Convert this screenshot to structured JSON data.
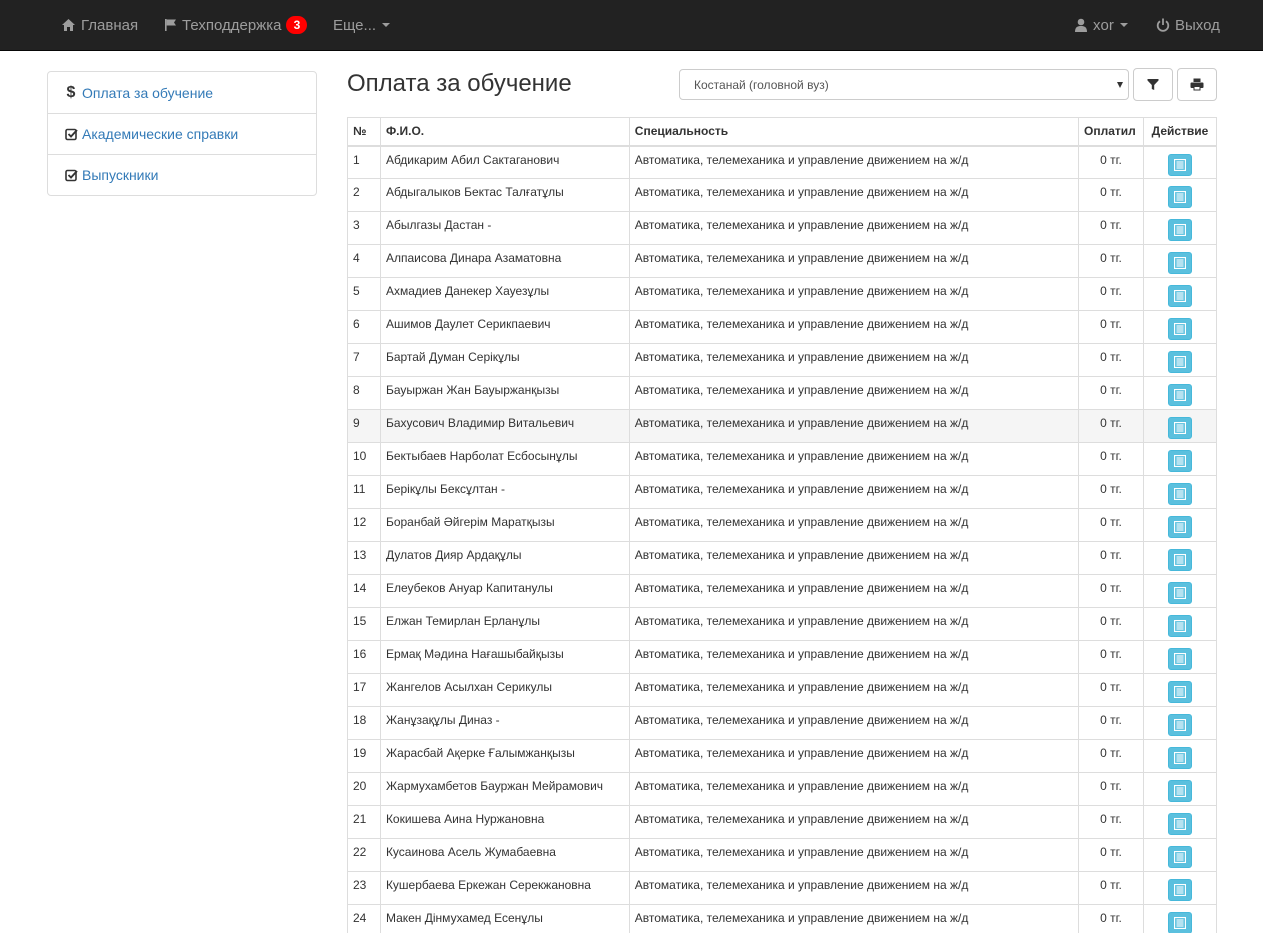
{
  "navbar": {
    "home": "Главная",
    "support": "Техподдержка",
    "support_badge": "3",
    "more": "Еще...",
    "user": "xor",
    "logout": "Выход"
  },
  "sidebar": {
    "items": [
      {
        "label": "Оплата за обучение",
        "icon": "dollar-icon"
      },
      {
        "label": "Академические справки",
        "icon": "check-square-icon"
      },
      {
        "label": "Выпускники",
        "icon": "check-square-icon"
      }
    ]
  },
  "header": {
    "title": "Оплата за обучение",
    "select_value": "Костанай (головной вуз)",
    "filter_icon": "filter-icon",
    "print_icon": "print-icon"
  },
  "table": {
    "columns": [
      "№",
      "Ф.И.О.",
      "Специальность",
      "Оплатил",
      "Действие"
    ],
    "highlighted_row": 9,
    "rows": [
      {
        "n": "1",
        "name": "Абдикарим Абил Сактаганович",
        "spec": "Автоматика, телемеханика и управление движением на ж/д",
        "paid": "0 тг."
      },
      {
        "n": "2",
        "name": "Абдыгалыков Бектас Талғатұлы",
        "spec": "Автоматика, телемеханика и управление движением на ж/д",
        "paid": "0 тг."
      },
      {
        "n": "3",
        "name": "Абылгазы Дастан -",
        "spec": "Автоматика, телемеханика и управление движением на ж/д",
        "paid": "0 тг."
      },
      {
        "n": "4",
        "name": "Алпаисова Динара Азаматовна",
        "spec": "Автоматика, телемеханика и управление движением на ж/д",
        "paid": "0 тг."
      },
      {
        "n": "5",
        "name": "Ахмадиев Данекер Хауезұлы",
        "spec": "Автоматика, телемеханика и управление движением на ж/д",
        "paid": "0 тг."
      },
      {
        "n": "6",
        "name": "Ашимов Даулет Серикпаевич",
        "spec": "Автоматика, телемеханика и управление движением на ж/д",
        "paid": "0 тг."
      },
      {
        "n": "7",
        "name": "Бартай Думан Серікұлы",
        "spec": "Автоматика, телемеханика и управление движением на ж/д",
        "paid": "0 тг."
      },
      {
        "n": "8",
        "name": "Бауыржан Жан Бауыржанқызы",
        "spec": "Автоматика, телемеханика и управление движением на ж/д",
        "paid": "0 тг."
      },
      {
        "n": "9",
        "name": "Бахусович Владимир Витальевич",
        "spec": "Автоматика, телемеханика и управление движением на ж/д",
        "paid": "0 тг."
      },
      {
        "n": "10",
        "name": "Бектыбаев Нарболат Есбосынұлы",
        "spec": "Автоматика, телемеханика и управление движением на ж/д",
        "paid": "0 тг."
      },
      {
        "n": "11",
        "name": "Берікұлы Бексұлтан -",
        "spec": "Автоматика, телемеханика и управление движением на ж/д",
        "paid": "0 тг."
      },
      {
        "n": "12",
        "name": "Боранбай Әйгерім Маратқызы",
        "spec": "Автоматика, телемеханика и управление движением на ж/д",
        "paid": "0 тг."
      },
      {
        "n": "13",
        "name": "Дулатов Дияр Ардақұлы",
        "spec": "Автоматика, телемеханика и управление движением на ж/д",
        "paid": "0 тг."
      },
      {
        "n": "14",
        "name": "Елеубеков Ануар Капитанулы",
        "spec": "Автоматика, телемеханика и управление движением на ж/д",
        "paid": "0 тг."
      },
      {
        "n": "15",
        "name": "Елжан Темирлан Ерланұлы",
        "spec": "Автоматика, телемеханика и управление движением на ж/д",
        "paid": "0 тг."
      },
      {
        "n": "16",
        "name": "Ермақ Мәдина Нағашыбайқызы",
        "spec": "Автоматика, телемеханика и управление движением на ж/д",
        "paid": "0 тг."
      },
      {
        "n": "17",
        "name": "Жангелов Асылхан Серикулы",
        "spec": "Автоматика, телемеханика и управление движением на ж/д",
        "paid": "0 тг."
      },
      {
        "n": "18",
        "name": "Жанұзақұлы Диназ -",
        "spec": "Автоматика, телемеханика и управление движением на ж/д",
        "paid": "0 тг."
      },
      {
        "n": "19",
        "name": "Жарасбай Ақерке Ғалымжанқызы",
        "spec": "Автоматика, телемеханика и управление движением на ж/д",
        "paid": "0 тг."
      },
      {
        "n": "20",
        "name": "Жармухамбетов Бауржан Мейрамович",
        "spec": "Автоматика, телемеханика и управление движением на ж/д",
        "paid": "0 тг."
      },
      {
        "n": "21",
        "name": "Кокишева Аина Нуржановна",
        "spec": "Автоматика, телемеханика и управление движением на ж/д",
        "paid": "0 тг."
      },
      {
        "n": "22",
        "name": "Кусаинова Асель Жумабаевна",
        "spec": "Автоматика, телемеханика и управление движением на ж/д",
        "paid": "0 тг."
      },
      {
        "n": "23",
        "name": "Кушербаева Еркежан Серекжановна",
        "spec": "Автоматика, телемеханика и управление движением на ж/д",
        "paid": "0 тг."
      },
      {
        "n": "24",
        "name": "Макен Дінмухамед Есенұлы",
        "spec": "Автоматика, телемеханика и управление движением на ж/д",
        "paid": "0 тг."
      }
    ]
  }
}
